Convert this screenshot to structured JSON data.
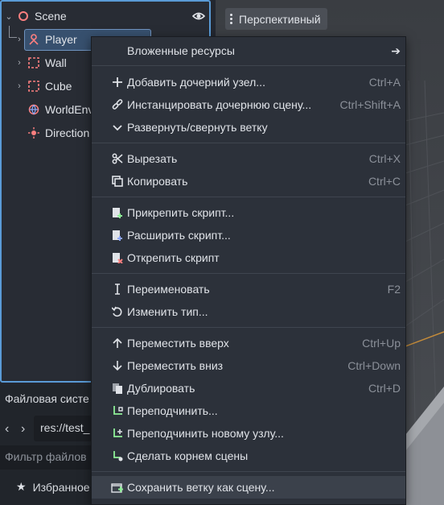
{
  "scene_tree": {
    "root_label": "Scene",
    "nodes": [
      {
        "label": "Player"
      },
      {
        "label": "Wall"
      },
      {
        "label": "Cube"
      },
      {
        "label": "WorldEnv"
      },
      {
        "label": "Direction"
      }
    ]
  },
  "filesystem": {
    "title": "Файловая систе",
    "path": "res://test_",
    "filter_placeholder": "Фильтр файлов",
    "favorites_label": "Избранное"
  },
  "viewport": {
    "perspective_label": "Перспективный"
  },
  "context_menu": {
    "items": [
      {
        "label": "Вложенные ресурсы",
        "shortcut": "",
        "icon": "submenu-arrow-icon"
      },
      {
        "label": "Добавить дочерний узел...",
        "shortcut": "Ctrl+A",
        "icon": "add-icon"
      },
      {
        "label": "Инстанцировать дочернюю сцену...",
        "shortcut": "Ctrl+Shift+A",
        "icon": "link-icon"
      },
      {
        "label": "Развернуть/свернуть ветку",
        "shortcut": "",
        "icon": "chevron-down-icon"
      },
      {
        "label": "Вырезать",
        "shortcut": "Ctrl+X",
        "icon": "scissors-icon"
      },
      {
        "label": "Копировать",
        "shortcut": "Ctrl+C",
        "icon": "copy-icon"
      },
      {
        "label": "Прикрепить скрипт...",
        "shortcut": "",
        "icon": "script-attach-icon"
      },
      {
        "label": "Расширить скрипт...",
        "shortcut": "",
        "icon": "script-extend-icon"
      },
      {
        "label": "Открепить скрипт",
        "shortcut": "",
        "icon": "script-detach-icon"
      },
      {
        "label": "Переименовать",
        "shortcut": "F2",
        "icon": "rename-icon"
      },
      {
        "label": "Изменить тип...",
        "shortcut": "",
        "icon": "change-type-icon"
      },
      {
        "label": "Переместить вверх",
        "shortcut": "Ctrl+Up",
        "icon": "move-up-icon"
      },
      {
        "label": "Переместить вниз",
        "shortcut": "Ctrl+Down",
        "icon": "move-down-icon"
      },
      {
        "label": "Дублировать",
        "shortcut": "Ctrl+D",
        "icon": "duplicate-icon"
      },
      {
        "label": "Переподчинить...",
        "shortcut": "",
        "icon": "reparent-icon"
      },
      {
        "label": "Переподчинить новому узлу...",
        "shortcut": "",
        "icon": "reparent-new-icon"
      },
      {
        "label": "Сделать корнем сцены",
        "shortcut": "",
        "icon": "make-root-icon"
      },
      {
        "label": "Сохранить ветку как сцену...",
        "shortcut": "",
        "icon": "save-branch-icon"
      }
    ]
  },
  "colors": {
    "accent": "#5a9bd6",
    "node3d_red": "#fc7f7f",
    "script_green": "#8eef97",
    "menu_bg": "#2c313a"
  }
}
